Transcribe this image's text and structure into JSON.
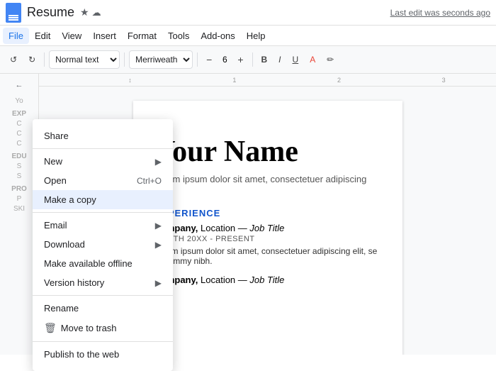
{
  "window": {
    "title": "Resume",
    "last_edit": "Last edit was seconds ago"
  },
  "top_bar": {
    "doc_icon_alt": "Google Docs icon",
    "title": "Resume",
    "star_icon": "★",
    "cloud_icon": "☁"
  },
  "menu_bar": {
    "items": [
      "File",
      "Edit",
      "View",
      "Insert",
      "Format",
      "Tools",
      "Add-ons",
      "Help"
    ]
  },
  "toolbar": {
    "undo_label": "↺",
    "redo_label": "↻",
    "style_select": "Normal text",
    "font_select": "Merriweather...",
    "font_size": "6",
    "bold": "B",
    "italic": "I",
    "underline": "U",
    "font_color": "A",
    "highlight": "✏"
  },
  "dropdown": {
    "sections": [
      {
        "items": [
          {
            "label": "Share",
            "shortcut": "",
            "has_arrow": false,
            "highlighted": false,
            "has_trash": false
          }
        ]
      },
      {
        "items": [
          {
            "label": "New",
            "shortcut": "",
            "has_arrow": true,
            "highlighted": false,
            "has_trash": false
          },
          {
            "label": "Open",
            "shortcut": "Ctrl+O",
            "has_arrow": false,
            "highlighted": false,
            "has_trash": false
          },
          {
            "label": "Make a copy",
            "shortcut": "",
            "has_arrow": false,
            "highlighted": true,
            "has_trash": false
          }
        ]
      },
      {
        "items": [
          {
            "label": "Email",
            "shortcut": "",
            "has_arrow": true,
            "highlighted": false,
            "has_trash": false
          },
          {
            "label": "Download",
            "shortcut": "",
            "has_arrow": true,
            "highlighted": false,
            "has_trash": false
          },
          {
            "label": "Make available offline",
            "shortcut": "",
            "has_arrow": false,
            "highlighted": false,
            "has_trash": false
          },
          {
            "label": "Version history",
            "shortcut": "",
            "has_arrow": true,
            "highlighted": false,
            "has_trash": false
          }
        ]
      },
      {
        "items": [
          {
            "label": "Rename",
            "shortcut": "",
            "has_arrow": false,
            "highlighted": false,
            "has_trash": false
          },
          {
            "label": "Move to trash",
            "shortcut": "",
            "has_arrow": false,
            "highlighted": false,
            "has_trash": true
          }
        ]
      },
      {
        "items": [
          {
            "label": "Publish to the web",
            "shortcut": "",
            "has_arrow": false,
            "highlighted": false,
            "has_trash": false
          }
        ]
      }
    ]
  },
  "document": {
    "cursor": "|",
    "name": "Your Name",
    "subtitle": "Lorem ipsum dolor sit amet, consectetuer adipiscing elit",
    "section1": "EXPERIENCE",
    "company1": "Company,",
    "location1": " Location — ",
    "jobtitle1": "Job Title",
    "date1": "MONTH 20XX - PRESENT",
    "body1": "Lorem ipsum dolor sit amet, consectetuer adipiscing elit, se nonummy nibh.",
    "company2": "Company,",
    "location2": " Location — ",
    "jobtitle2": "Job Title"
  },
  "sidebar": {
    "back_label": "←",
    "section_labels": [
      "Yo",
      "EXP",
      "C",
      "C",
      "C",
      "EDU",
      "S",
      "S",
      "PRO",
      "P",
      "SKI"
    ]
  }
}
